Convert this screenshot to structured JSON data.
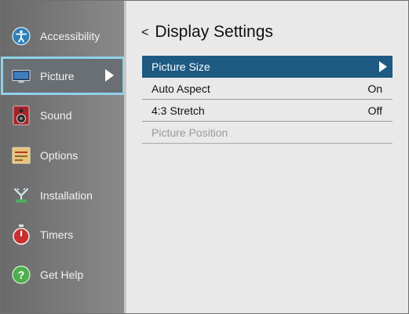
{
  "sidebar": {
    "items": [
      {
        "label": "Accessibility",
        "icon": "accessibility-icon"
      },
      {
        "label": "Picture",
        "icon": "tv-icon"
      },
      {
        "label": "Sound",
        "icon": "speaker-icon"
      },
      {
        "label": "Options",
        "icon": "options-icon"
      },
      {
        "label": "Installation",
        "icon": "antenna-icon"
      },
      {
        "label": "Timers",
        "icon": "stopwatch-icon"
      },
      {
        "label": "Get Help",
        "icon": "help-icon"
      }
    ],
    "active_index": 1
  },
  "main": {
    "back_symbol": "<",
    "title": "Display Settings",
    "rows": [
      {
        "label": "Picture Size",
        "value": "",
        "selected": true,
        "disabled": false
      },
      {
        "label": "Auto Aspect",
        "value": "On",
        "selected": false,
        "disabled": false
      },
      {
        "label": "4:3 Stretch",
        "value": "Off",
        "selected": false,
        "disabled": false
      },
      {
        "label": "Picture Position",
        "value": "",
        "selected": false,
        "disabled": true
      }
    ]
  },
  "colors": {
    "highlight": "#1e5a82",
    "focus_border": "#8fd1ea"
  }
}
